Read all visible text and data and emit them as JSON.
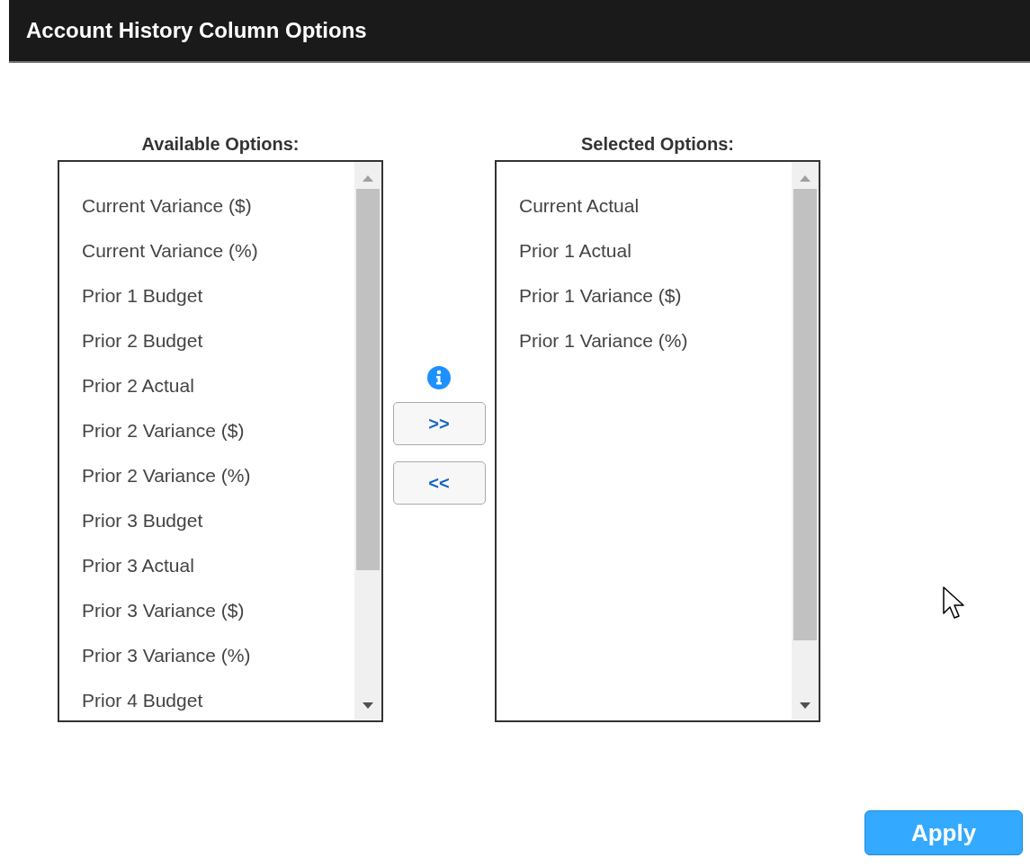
{
  "window": {
    "title": "Account History Column Options"
  },
  "available": {
    "heading": "Available Options:",
    "items": [
      "Current Variance ($)",
      "Current Variance (%)",
      "Prior 1 Budget",
      "Prior 2 Budget",
      "Prior 2 Actual",
      "Prior 2 Variance ($)",
      "Prior 2 Variance (%)",
      "Prior 3 Budget",
      "Prior 3 Actual",
      "Prior 3 Variance ($)",
      "Prior 3 Variance (%)",
      "Prior 4 Budget"
    ]
  },
  "move_buttons": [
    ">>",
    "<<"
  ],
  "selected": {
    "heading": "Selected Options:",
    "items": [
      "Current Actual",
      "Prior 1 Actual",
      "Prior 1 Variance ($)",
      "Prior 1 Variance (%)"
    ]
  },
  "apply_button": "Apply"
}
